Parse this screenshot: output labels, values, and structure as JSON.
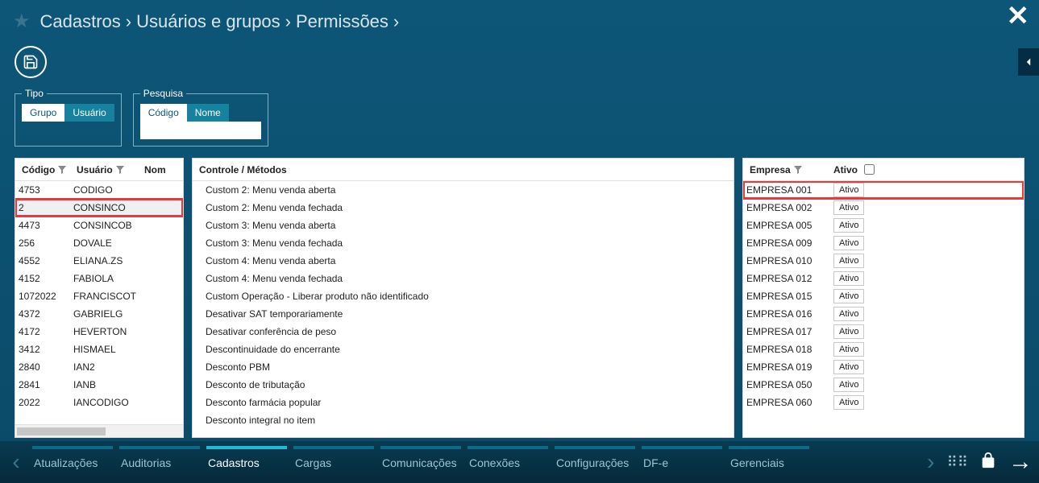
{
  "breadcrumb": [
    "Cadastros",
    "Usuários e grupos",
    "Permissões"
  ],
  "form": {
    "tipo_legend": "Tipo",
    "tipo_options": {
      "grupo": "Grupo",
      "usuario": "Usuário"
    },
    "tipo_active": "usuario",
    "pesquisa_legend": "Pesquisa",
    "pesquisa_options": {
      "codigo": "Código",
      "nome": "Nome"
    },
    "pesquisa_active": "nome",
    "search_value": ""
  },
  "left": {
    "headers": {
      "codigo": "Código",
      "usuario": "Usuário",
      "nome": "Nom"
    },
    "rows": [
      {
        "codigo": "4753",
        "usuario": "CODIGO"
      },
      {
        "codigo": "2",
        "usuario": "CONSINCO",
        "highlighted": true
      },
      {
        "codigo": "4473",
        "usuario": "CONSINCOB"
      },
      {
        "codigo": "256",
        "usuario": "DOVALE"
      },
      {
        "codigo": "4552",
        "usuario": "ELIANA.ZS"
      },
      {
        "codigo": "4152",
        "usuario": "FABIOLA"
      },
      {
        "codigo": "1072022",
        "usuario": "FRANCISCOT"
      },
      {
        "codigo": "4372",
        "usuario": "GABRIELG"
      },
      {
        "codigo": "4172",
        "usuario": "HEVERTON"
      },
      {
        "codigo": "3412",
        "usuario": "HISMAEL"
      },
      {
        "codigo": "2840",
        "usuario": "IAN2"
      },
      {
        "codigo": "2841",
        "usuario": "IANB"
      },
      {
        "codigo": "2022",
        "usuario": "IANCODIGO"
      }
    ]
  },
  "mid": {
    "header": "Controle / Métodos",
    "rows": [
      {
        "label": "Custom 2: Menu venda aberta"
      },
      {
        "label": "Custom 2: Menu venda fechada"
      },
      {
        "label": "Custom 3: Menu venda aberta"
      },
      {
        "label": "Custom 3: Menu venda fechada"
      },
      {
        "label": "Custom 4: Menu venda aberta"
      },
      {
        "label": "Custom 4: Menu venda fechada"
      },
      {
        "label": "Custom Operação - Liberar produto não identificado",
        "selected": true
      },
      {
        "label": "Desativar SAT temporariamente"
      },
      {
        "label": "Desativar conferência de peso"
      },
      {
        "label": "Descontinuidade do encerrante"
      },
      {
        "label": "Desconto PBM"
      },
      {
        "label": "Desconto de tributação"
      },
      {
        "label": "Desconto farmácia popular"
      },
      {
        "label": "Desconto integral no item"
      }
    ]
  },
  "right": {
    "headers": {
      "empresa": "Empresa",
      "ativo": "Ativo"
    },
    "rows": [
      {
        "empresa": "EMPRESA 001",
        "ativo": "Ativo",
        "highlighted": true
      },
      {
        "empresa": "EMPRESA 002",
        "ativo": "Ativo"
      },
      {
        "empresa": "EMPRESA 005",
        "ativo": "Ativo"
      },
      {
        "empresa": "EMPRESA 009",
        "ativo": "Ativo"
      },
      {
        "empresa": "EMPRESA 010",
        "ativo": "Ativo"
      },
      {
        "empresa": "EMPRESA 012",
        "ativo": "Ativo"
      },
      {
        "empresa": "EMPRESA 015",
        "ativo": "Ativo"
      },
      {
        "empresa": "EMPRESA 016",
        "ativo": "Ativo"
      },
      {
        "empresa": "EMPRESA 017",
        "ativo": "Ativo"
      },
      {
        "empresa": "EMPRESA 018",
        "ativo": "Ativo"
      },
      {
        "empresa": "EMPRESA 019",
        "ativo": "Ativo"
      },
      {
        "empresa": "EMPRESA 050",
        "ativo": "Ativo"
      },
      {
        "empresa": "EMPRESA 060",
        "ativo": "Ativo"
      }
    ]
  },
  "bottom_tabs": [
    {
      "label": "Atualizações"
    },
    {
      "label": "Auditorias"
    },
    {
      "label": "Cadastros",
      "active": true
    },
    {
      "label": "Cargas"
    },
    {
      "label": "Comunicações"
    },
    {
      "label": "Conexões"
    },
    {
      "label": "Configurações"
    },
    {
      "label": "DF-e"
    },
    {
      "label": "Gerenciais"
    }
  ]
}
